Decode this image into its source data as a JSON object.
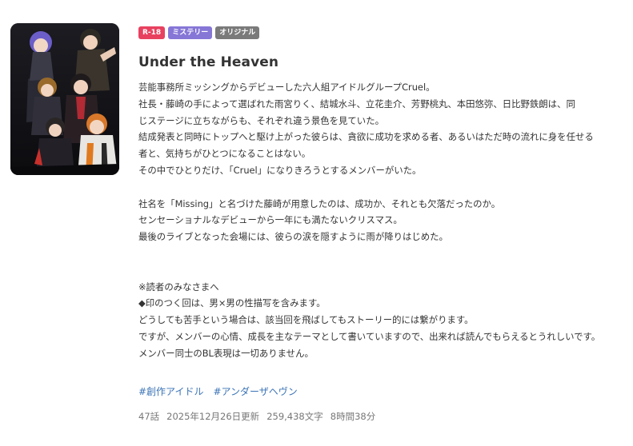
{
  "badges": [
    {
      "label": "R-18",
      "color": "#e8415f"
    },
    {
      "label": "ミステリー",
      "color": "#8676d6"
    },
    {
      "label": "オリジナル",
      "color": "#7a7a7a"
    }
  ],
  "title": "Under the Heaven",
  "synopsis": [
    "芸能事務所ミッシングからデビューした六人組アイドルグループCruel。",
    "社長・藤崎の手によって選ばれた雨宮りく、結城水斗、立花圭介、芳野桃丸、本田悠弥、日比野鉄朗は、同",
    "じステージに立ちながらも、それぞれ違う景色を見ていた。",
    "結成発表と同時にトップへと駆け上がった彼らは、貪欲に成功を求める者、あるいはただ時の流れに身を任せる",
    "者と、気持ちがひとつになることはない。",
    "その中でひとりだけ、「Cruel」になりきろうとするメンバーがいた。",
    "",
    "社名を「Missing」と名づけた藤崎が用意したのは、成功か、それとも欠落だったのか。",
    "センセーショナルなデビューから一年にも満たないクリスマス。",
    "最後のライブとなった会場には、彼らの涙を隠すように雨が降りはじめた。",
    "",
    "",
    "※読者のみなさまへ",
    "◆印のつく回は、男×男の性描写を含みます。",
    "どうしても苦手という場合は、該当回を飛ばしてもストーリー的には繋がります。",
    "ですが、メンバーの心情、成長を主なテーマとして書いていますので、出来れば読んでもらえるとうれしいです。",
    "メンバー同士のBL表現は一切ありません。"
  ],
  "hashtags": [
    "#創作アイドル",
    "#アンダーザヘヴン"
  ],
  "meta": {
    "episodes": "47話",
    "updated": "2025年12月26日更新",
    "chars": "259,438文字",
    "reading_time": "8時間38分"
  },
  "colors": {
    "text": "#333333",
    "link": "#3a73b6",
    "muted": "#777777"
  },
  "cover_art": "group-of-six-anime-idols-illustration"
}
